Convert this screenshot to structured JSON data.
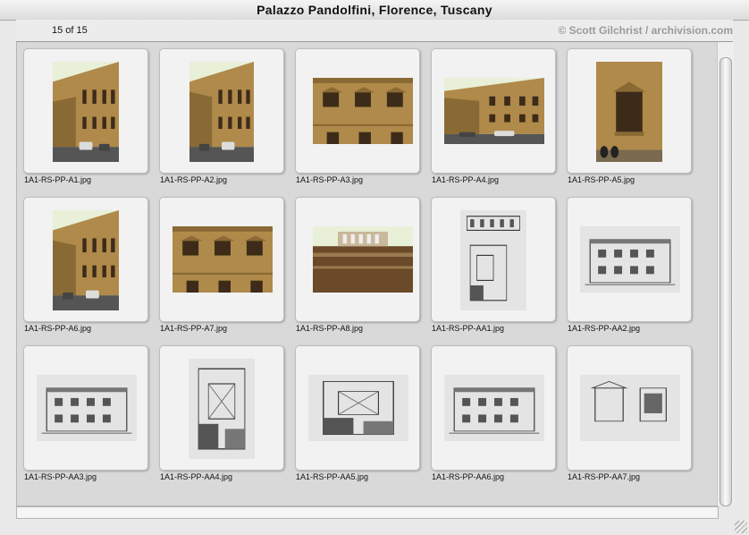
{
  "window": {
    "title": "Palazzo Pandolfini, Florence, Tuscany"
  },
  "header": {
    "counter": "15 of 15",
    "credit": "© Scott Gilchrist / archivision.com"
  },
  "icons": {
    "scroll_thumb": "vertical-scroll-thumb",
    "resize": "resize-grip-icon"
  },
  "items": [
    {
      "filename": "1A1-RS-PP-A1.jpg",
      "kind": "photo-street-perspective"
    },
    {
      "filename": "1A1-RS-PP-A2.jpg",
      "kind": "photo-corner-facade"
    },
    {
      "filename": "1A1-RS-PP-A3.jpg",
      "kind": "photo-facade-windows"
    },
    {
      "filename": "1A1-RS-PP-A4.jpg",
      "kind": "photo-street-cars"
    },
    {
      "filename": "1A1-RS-PP-A5.jpg",
      "kind": "photo-window-scooter"
    },
    {
      "filename": "1A1-RS-PP-A6.jpg",
      "kind": "photo-side-wall"
    },
    {
      "filename": "1A1-RS-PP-A7.jpg",
      "kind": "photo-facade-cornice"
    },
    {
      "filename": "1A1-RS-PP-A8.jpg",
      "kind": "photo-balustrade"
    },
    {
      "filename": "1A1-RS-PP-AA1.jpg",
      "kind": "drawing-plan-elevation"
    },
    {
      "filename": "1A1-RS-PP-AA2.jpg",
      "kind": "drawing-elevation-plan"
    },
    {
      "filename": "1A1-RS-PP-AA3.jpg",
      "kind": "drawing-elevation"
    },
    {
      "filename": "1A1-RS-PP-AA4.jpg",
      "kind": "drawing-floor-plan"
    },
    {
      "filename": "1A1-RS-PP-AA5.jpg",
      "kind": "drawing-plan-section"
    },
    {
      "filename": "1A1-RS-PP-AA6.jpg",
      "kind": "drawing-section"
    },
    {
      "filename": "1A1-RS-PP-AA7.jpg",
      "kind": "drawing-window-detail"
    }
  ]
}
